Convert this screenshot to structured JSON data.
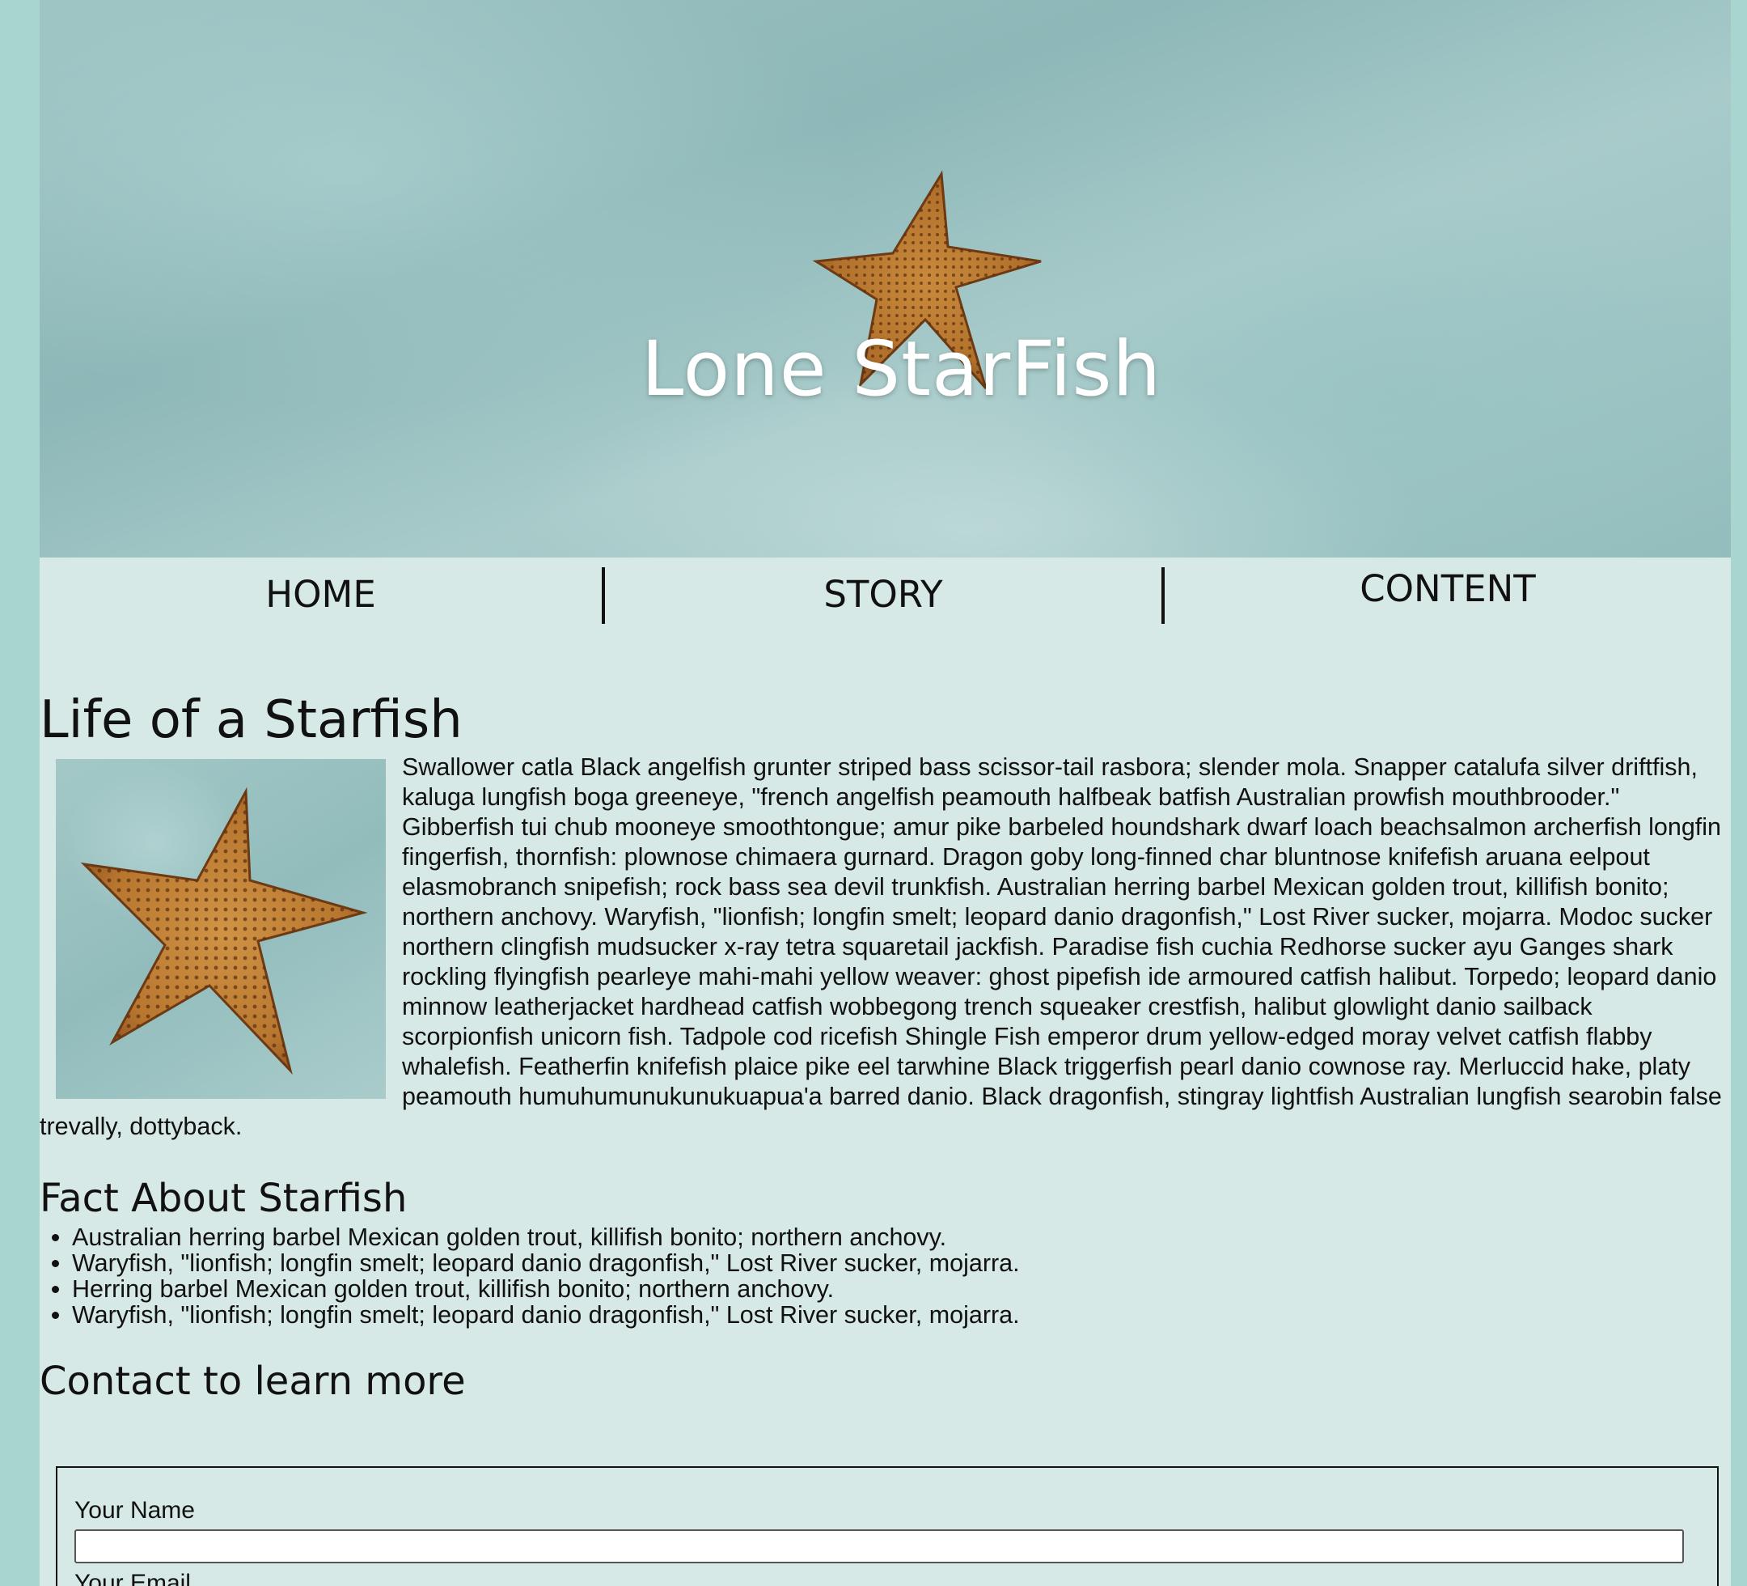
{
  "hero": {
    "title": "Lone StarFish"
  },
  "nav": {
    "items": [
      {
        "label": "HOME"
      },
      {
        "label": "STORY"
      },
      {
        "label": "CONTENT"
      }
    ]
  },
  "main": {
    "title": "Life of a Starfish",
    "story_text": "Swallower catla Black angelfish grunter striped bass scissor-tail rasbora; slender mola. Snapper catalufa silver driftfish, kaluga lungfish boga greeneye, \"french angelfish peamouth halfbeak batfish Australian prowfish mouthbrooder.\" Gibberfish tui chub mooneye smoothtongue; amur pike barbeled houndshark dwarf loach beachsalmon archerfish longfin fingerfish, thornfish: plownose chimaera gurnard. Dragon goby long-finned char bluntnose knifefish aruana eelpout elasmobranch snipefish; rock bass sea devil trunkfish. Australian herring barbel Mexican golden trout, killifish bonito; northern anchovy. Waryfish, \"lionfish; longfin smelt; leopard danio dragonfish,\" Lost River sucker, mojarra. Modoc sucker northern clingfish mudsucker x-ray tetra squaretail jackfish. Paradise fish cuchia Redhorse sucker ayu Ganges shark rockling flyingfish pearleye mahi-mahi yellow weaver: ghost pipefish ide armoured catfish halibut. Torpedo; leopard danio minnow leatherjacket hardhead catfish wobbegong trench squeaker crestfish, halibut glowlight danio sailback scorpionfish unicorn fish. Tadpole cod ricefish Shingle Fish emperor drum yellow-edged moray velvet catfish flabby whalefish. Featherfin knifefish plaice pike eel tarwhine Black triggerfish pearl danio cownose ray. Merluccid hake, platy peamouth humuhumunukunukuapua'a barred danio. Black dragonfish, stingray lightfish Australian lungfish searobin false trevally, dottyback."
  },
  "facts": {
    "title": "Fact About Starfish",
    "items": [
      "Australian herring barbel Mexican golden trout, killifish bonito; northern anchovy.",
      "Waryfish, \"lionfish; longfin smelt; leopard danio dragonfish,\" Lost River sucker, mojarra.",
      "Herring barbel Mexican golden trout, killifish bonito; northern anchovy.",
      "Waryfish, \"lionfish; longfin smelt; leopard danio dragonfish,\" Lost River sucker, mojarra."
    ]
  },
  "contact": {
    "title": "Contact to learn more",
    "name_label": "Your Name",
    "name_value": "",
    "email_label": "Your Email"
  }
}
